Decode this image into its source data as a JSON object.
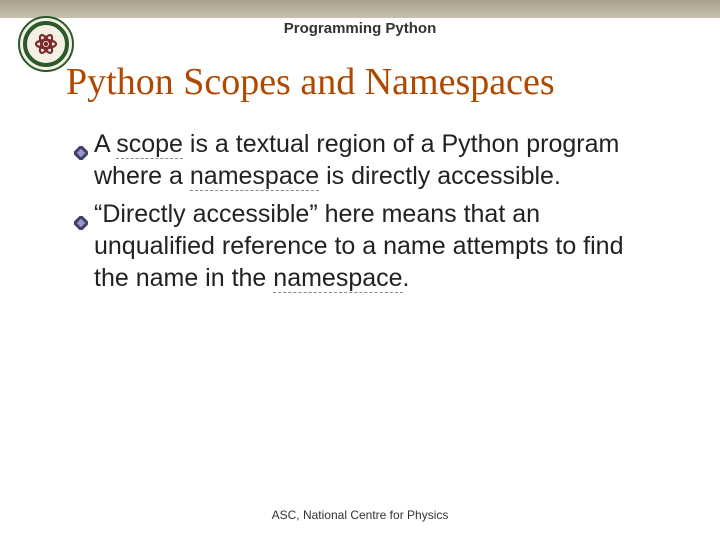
{
  "header": {
    "subtitle": "Programming Python"
  },
  "title": "Python Scopes and Namespaces",
  "bullets": [
    {
      "pre1": "A ",
      "u1": "scope",
      "mid": " is a textual region of a Python program where a ",
      "u2": "namespace",
      "post": " is directly accessible."
    },
    {
      "pre1": "“Directly accessible” here means that an unqualified reference to a name attempts to find the name in the ",
      "u1": "namespace",
      "post": "."
    }
  ],
  "footer": "ASC, National Centre for Physics"
}
